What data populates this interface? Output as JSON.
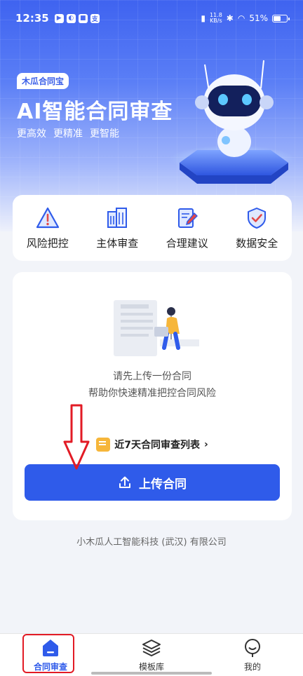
{
  "status_bar": {
    "time": "12:35",
    "net_speed_value": "11.8",
    "net_speed_unit": "KB/s",
    "battery": "51%"
  },
  "hero": {
    "brand_tag": "木瓜合同宝",
    "title": "AI智能合同审查",
    "subtitles": [
      "更高效",
      "更精准",
      "更智能"
    ]
  },
  "features": [
    {
      "label": "风险把控",
      "icon": "warning-triangle-icon"
    },
    {
      "label": "主体审查",
      "icon": "building-icon"
    },
    {
      "label": "合理建议",
      "icon": "edit-document-icon"
    },
    {
      "label": "数据安全",
      "icon": "shield-check-icon"
    }
  ],
  "upload_card": {
    "hint_line1": "请先上传一份合同",
    "hint_line2": "帮助你快速精准把控合同风险",
    "recent_link": "近7天合同审查列表",
    "upload_button": "上传合同"
  },
  "footer": {
    "company": "小木瓜人工智能科技 (武汉) 有限公司"
  },
  "bottom_nav": [
    {
      "label": "合同审查",
      "icon": "home-icon",
      "active": true
    },
    {
      "label": "模板库",
      "icon": "layers-icon",
      "active": false
    },
    {
      "label": "我的",
      "icon": "profile-icon",
      "active": false
    }
  ],
  "colors": {
    "primary": "#2f5bea",
    "hero_gradient_top": "#3f63f0",
    "annotation_red": "#e21b25",
    "accent_orange": "#f6b63a"
  }
}
